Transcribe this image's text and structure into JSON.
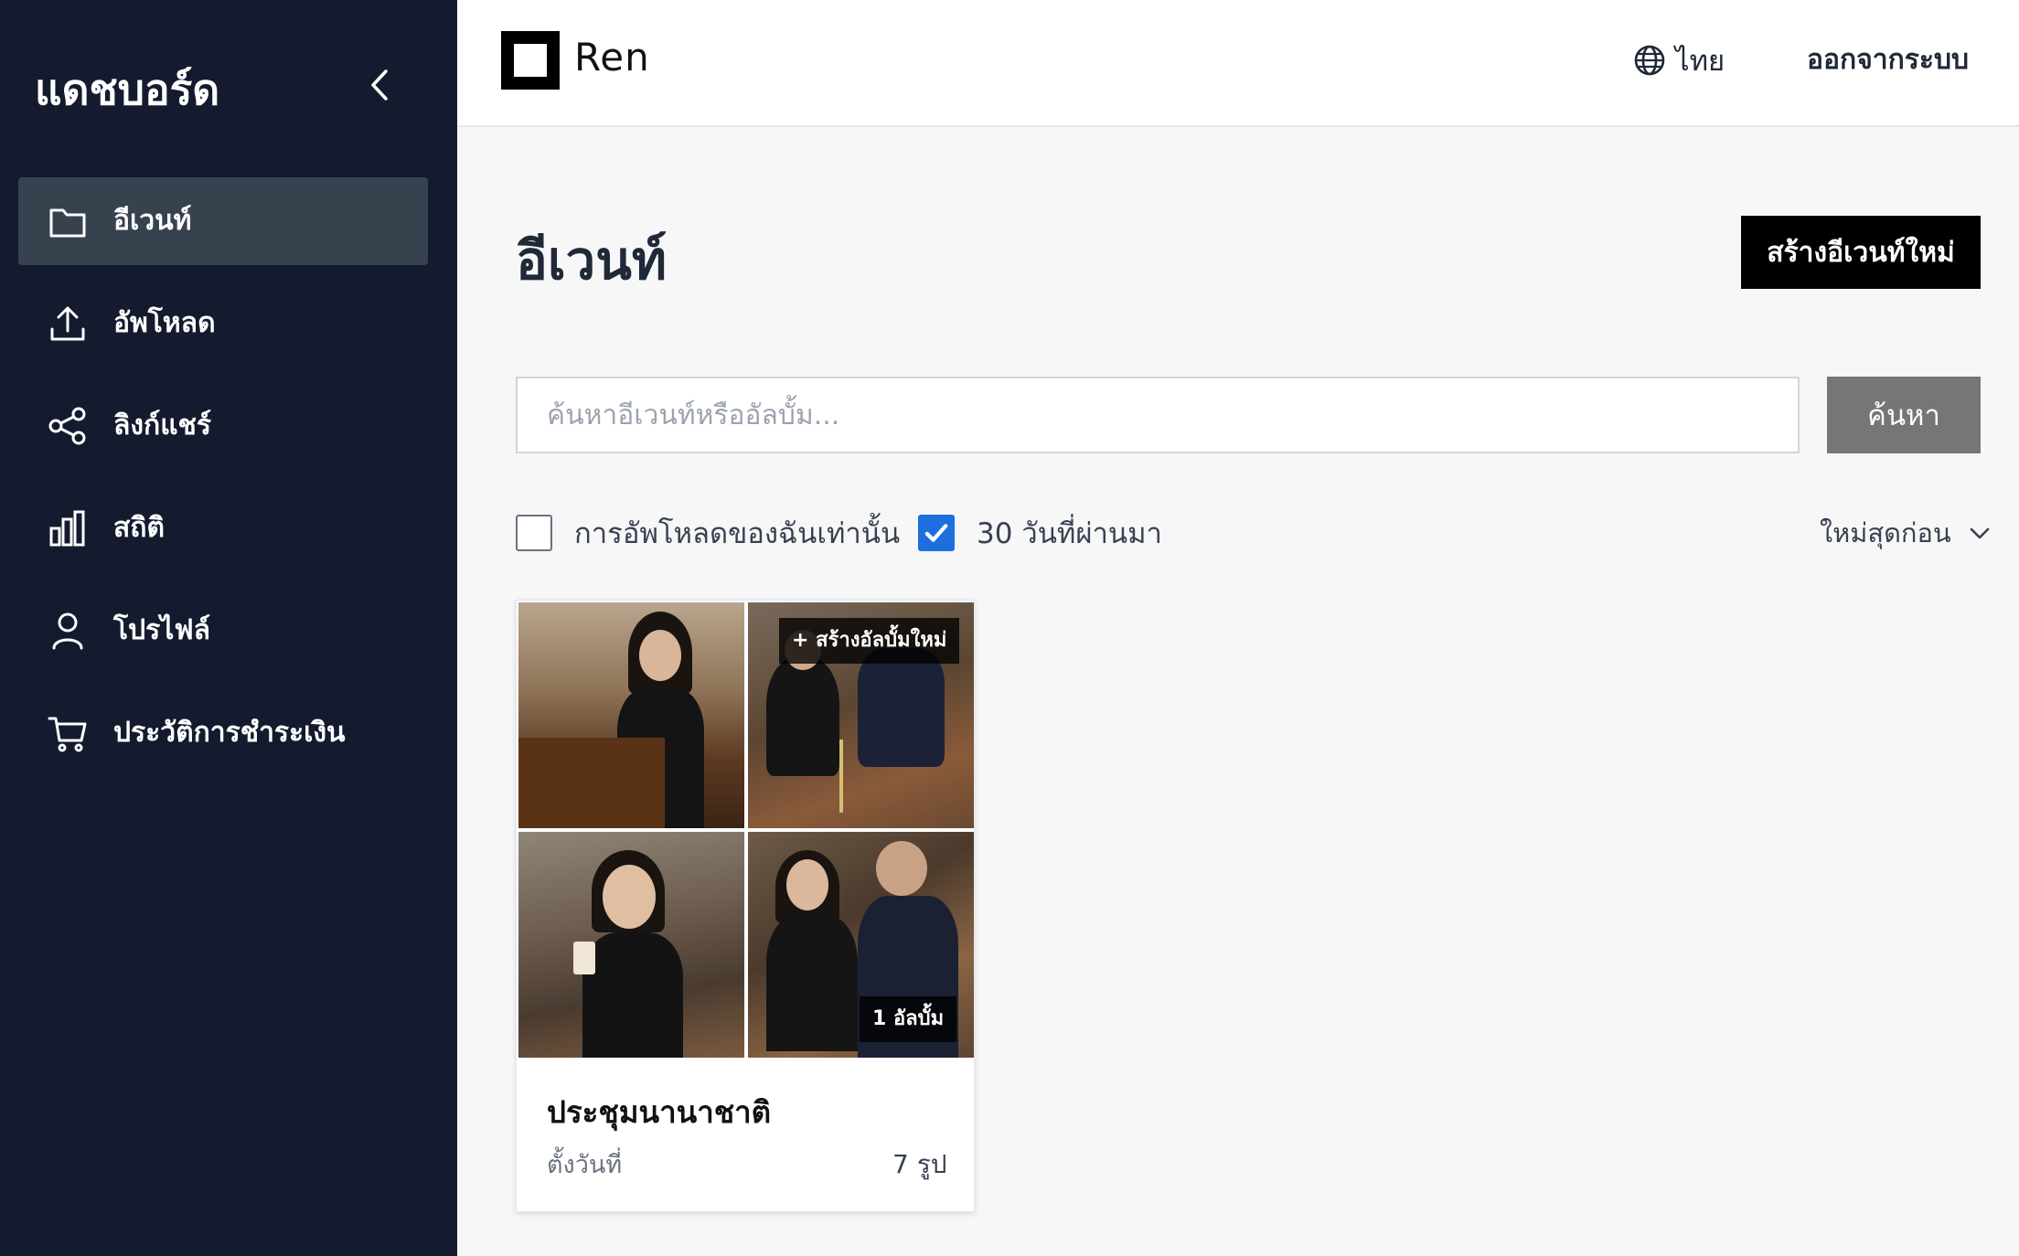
{
  "sidebar": {
    "brand": "แดชบอร์ด",
    "items": [
      {
        "label": "อีเวนท์",
        "icon": "folder-icon",
        "active": true
      },
      {
        "label": "อัพโหลด",
        "icon": "upload-icon",
        "active": false
      },
      {
        "label": "ลิงก์แชร์",
        "icon": "share-icon",
        "active": false
      },
      {
        "label": "สถิติ",
        "icon": "bar-chart-icon",
        "active": false
      },
      {
        "label": "โปรไฟล์",
        "icon": "user-icon",
        "active": false
      },
      {
        "label": "ประวัติการชำระเงิน",
        "icon": "cart-icon",
        "active": false
      }
    ]
  },
  "topbar": {
    "logo_text": "Ren",
    "language": "ไทย",
    "logout": "ออกจากระบบ"
  },
  "main": {
    "title": "อีเวนท์",
    "create_button": "สร้างอีเวนท์ใหม่",
    "search": {
      "placeholder": "ค้นหาอีเวนท์หรืออัลบั้ม...",
      "value": "",
      "button": "ค้นหา"
    },
    "filters": [
      {
        "label": "การอัพโหลดของฉันเท่านั้น",
        "checked": false
      },
      {
        "label": "30 วันที่ผ่านมา",
        "checked": true
      }
    ],
    "sort": "ใหม่สุดก่อน",
    "events": [
      {
        "create_album_label": "+ สร้างอัลบั้มใหม่",
        "album_count_label": "1 อัลบั้ม",
        "title": "ประชุมนานาชาติ",
        "subtitle": "ตั้งวันที่",
        "photo_count": "7 รูป"
      }
    ]
  },
  "colors": {
    "sidebar_bg": "#141b2f",
    "sidebar_active": "#37424f",
    "primary_button": "#000000",
    "search_button": "#767676",
    "checkbox_checked": "#1d6fe0"
  }
}
